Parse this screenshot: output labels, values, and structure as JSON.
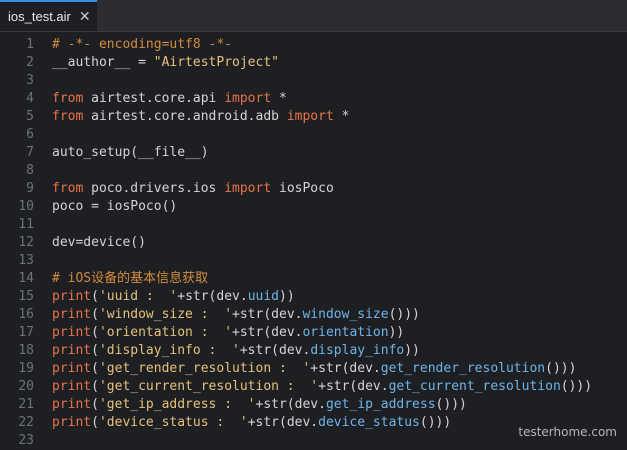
{
  "tab": {
    "title": "ios_test.air",
    "close": "✕"
  },
  "lines": [
    {
      "n": "1",
      "tokens": [
        [
          "t-comment",
          "# -*- encoding=utf8 -*-"
        ]
      ]
    },
    {
      "n": "2",
      "tokens": [
        [
          "t-ident",
          "__author__ = "
        ],
        [
          "t-string",
          "\"AirtestProject\""
        ]
      ]
    },
    {
      "n": "3",
      "tokens": []
    },
    {
      "n": "4",
      "tokens": [
        [
          "t-kw",
          "from"
        ],
        [
          "t-ident",
          " airtest.core.api "
        ],
        [
          "t-kw",
          "import"
        ],
        [
          "t-ident",
          " *"
        ]
      ]
    },
    {
      "n": "5",
      "tokens": [
        [
          "t-kw",
          "from"
        ],
        [
          "t-ident",
          " airtest.core.android.adb "
        ],
        [
          "t-kw",
          "import"
        ],
        [
          "t-ident",
          " *"
        ]
      ]
    },
    {
      "n": "6",
      "tokens": []
    },
    {
      "n": "7",
      "tokens": [
        [
          "t-ident",
          "auto_setup(__file__)"
        ]
      ]
    },
    {
      "n": "8",
      "tokens": []
    },
    {
      "n": "9",
      "tokens": [
        [
          "t-kw",
          "from"
        ],
        [
          "t-ident",
          " poco.drivers.ios "
        ],
        [
          "t-kw",
          "import"
        ],
        [
          "t-ident",
          " iosPoco"
        ]
      ]
    },
    {
      "n": "10",
      "tokens": [
        [
          "t-ident",
          "poco = iosPoco()"
        ]
      ]
    },
    {
      "n": "11",
      "tokens": []
    },
    {
      "n": "12",
      "tokens": [
        [
          "t-ident",
          "dev=device()"
        ]
      ]
    },
    {
      "n": "13",
      "tokens": []
    },
    {
      "n": "14",
      "tokens": [
        [
          "t-comment",
          "# iOS设备的基本信息获取"
        ]
      ]
    },
    {
      "n": "15",
      "tokens": [
        [
          "t-kw",
          "print"
        ],
        [
          "t-ident",
          "("
        ],
        [
          "t-string",
          "'uuid :  '"
        ],
        [
          "t-ident",
          "+str(dev."
        ],
        [
          "t-attr",
          "uuid"
        ],
        [
          "t-ident",
          "))"
        ]
      ]
    },
    {
      "n": "16",
      "tokens": [
        [
          "t-kw",
          "print"
        ],
        [
          "t-ident",
          "("
        ],
        [
          "t-string",
          "'window_size :  '"
        ],
        [
          "t-ident",
          "+str(dev."
        ],
        [
          "t-attr",
          "window_size"
        ],
        [
          "t-ident",
          "()))"
        ]
      ]
    },
    {
      "n": "17",
      "tokens": [
        [
          "t-kw",
          "print"
        ],
        [
          "t-ident",
          "("
        ],
        [
          "t-string",
          "'orientation :  '"
        ],
        [
          "t-ident",
          "+str(dev."
        ],
        [
          "t-attr",
          "orientation"
        ],
        [
          "t-ident",
          "))"
        ]
      ]
    },
    {
      "n": "18",
      "tokens": [
        [
          "t-kw",
          "print"
        ],
        [
          "t-ident",
          "("
        ],
        [
          "t-string",
          "'display_info :  '"
        ],
        [
          "t-ident",
          "+str(dev."
        ],
        [
          "t-attr",
          "display_info"
        ],
        [
          "t-ident",
          "))"
        ]
      ]
    },
    {
      "n": "19",
      "tokens": [
        [
          "t-kw",
          "print"
        ],
        [
          "t-ident",
          "("
        ],
        [
          "t-string",
          "'get_render_resolution :  '"
        ],
        [
          "t-ident",
          "+str(dev."
        ],
        [
          "t-attr",
          "get_render_resolution"
        ],
        [
          "t-ident",
          "()))"
        ]
      ]
    },
    {
      "n": "20",
      "tokens": [
        [
          "t-kw",
          "print"
        ],
        [
          "t-ident",
          "("
        ],
        [
          "t-string",
          "'get_current_resolution :  '"
        ],
        [
          "t-ident",
          "+str(dev."
        ],
        [
          "t-attr",
          "get_current_resolution"
        ],
        [
          "t-ident",
          "()))"
        ]
      ]
    },
    {
      "n": "21",
      "tokens": [
        [
          "t-kw",
          "print"
        ],
        [
          "t-ident",
          "("
        ],
        [
          "t-string",
          "'get_ip_address :  '"
        ],
        [
          "t-ident",
          "+str(dev."
        ],
        [
          "t-attr",
          "get_ip_address"
        ],
        [
          "t-ident",
          "()))"
        ]
      ]
    },
    {
      "n": "22",
      "tokens": [
        [
          "t-kw",
          "print"
        ],
        [
          "t-ident",
          "("
        ],
        [
          "t-string",
          "'device_status :  '"
        ],
        [
          "t-ident",
          "+str(dev."
        ],
        [
          "t-attr",
          "device_status"
        ],
        [
          "t-ident",
          "()))"
        ]
      ]
    },
    {
      "n": "23",
      "tokens": []
    }
  ],
  "watermark": "testerhome.com"
}
